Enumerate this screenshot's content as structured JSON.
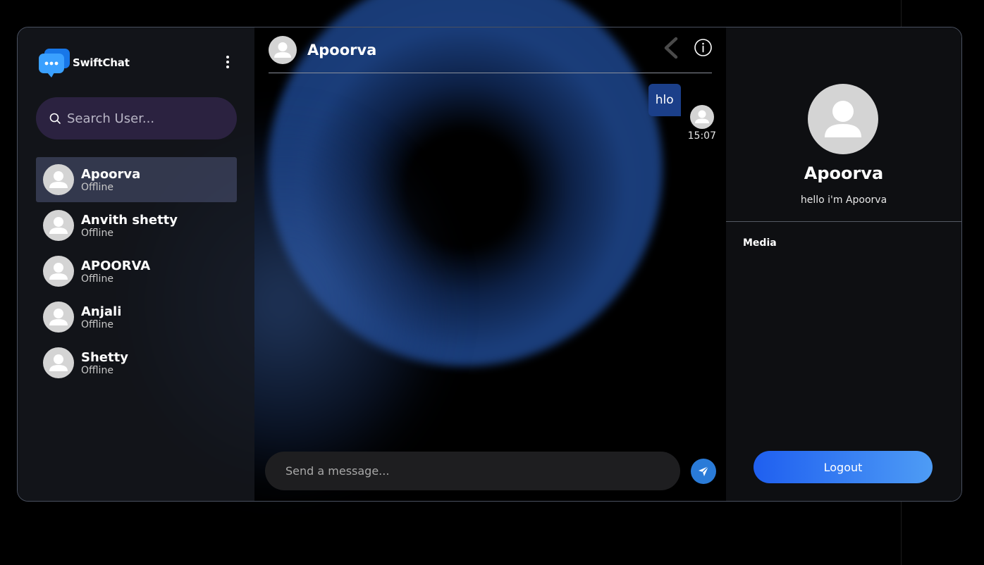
{
  "brand": {
    "name": "SwiftChat",
    "logo_icon": "chat-bubble-icon",
    "accent": "#2a8df5"
  },
  "search": {
    "placeholder": "Search User..."
  },
  "users": [
    {
      "name": "Apoorva",
      "status": "Offline",
      "active": true
    },
    {
      "name": "Anvith shetty",
      "status": "Offline",
      "active": false
    },
    {
      "name": "APOORVA",
      "status": "Offline",
      "active": false
    },
    {
      "name": "Anjali",
      "status": "Offline",
      "active": false
    },
    {
      "name": "Shetty",
      "status": "Offline",
      "active": false
    }
  ],
  "chat": {
    "title": "Apoorva",
    "messages": [
      {
        "text": "hlo",
        "time": "15:07",
        "outgoing": true
      }
    ],
    "composer_placeholder": "Send a message...",
    "bubble_color": "#1b3f89",
    "send_color": "#2a7bd8"
  },
  "profile": {
    "name": "Apoorva",
    "bio": "hello i'm Apoorva",
    "media_label": "Media",
    "logout_label": "Logout"
  }
}
